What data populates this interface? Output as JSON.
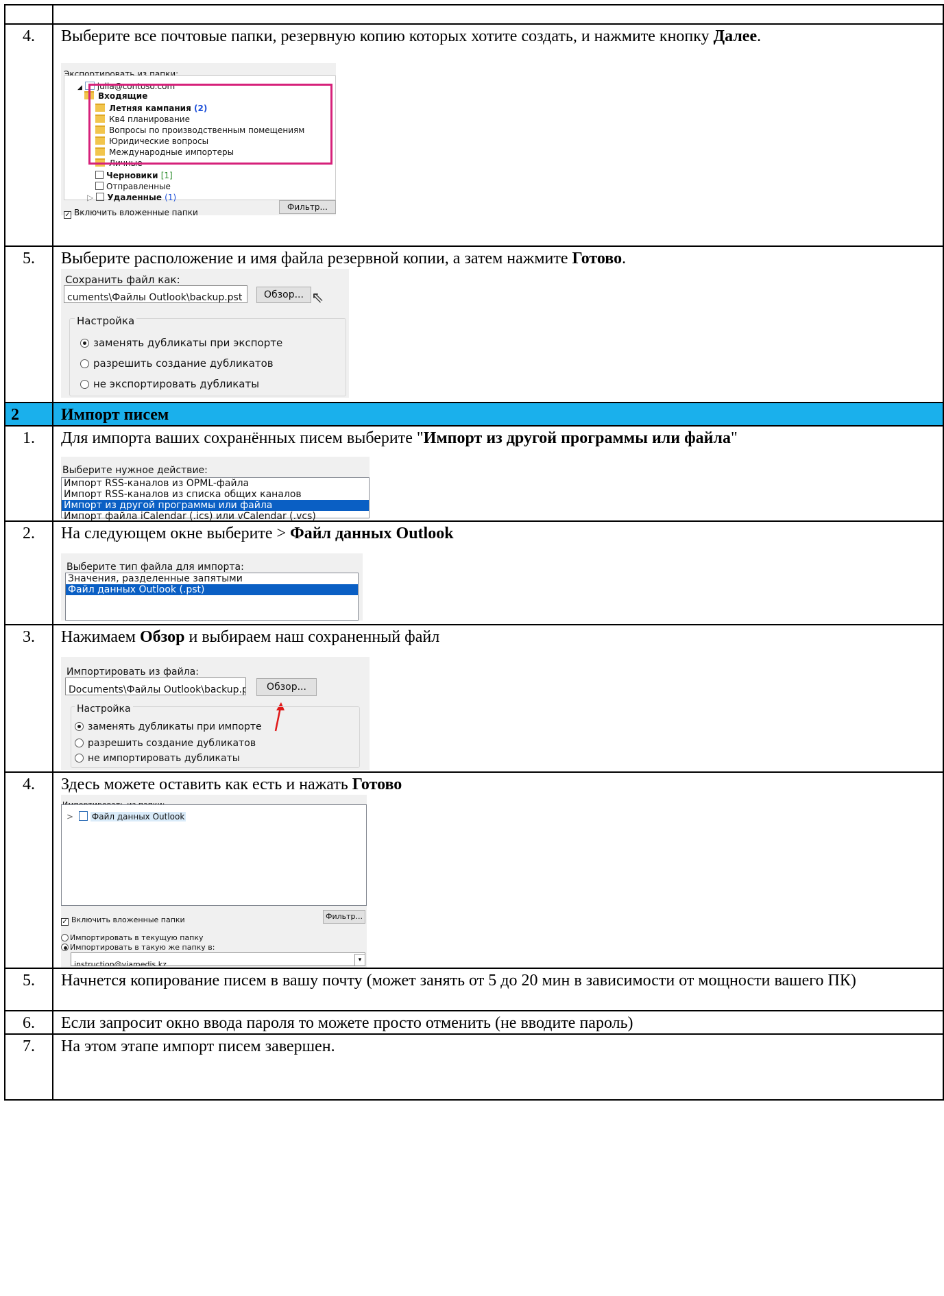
{
  "rows": {
    "r4a": {
      "num": "4.",
      "text_pre": "Выберите все почтовые папки, резервную копию которых хотите создать, и нажмите кнопку ",
      "text_bold": "Далее",
      "text_post": "."
    },
    "r5a": {
      "num": "5.",
      "text_pre": "Выберите расположение и имя файла резервной копии, а затем нажмите ",
      "text_bold": "Готово",
      "text_post": "."
    },
    "section": {
      "num": "2",
      "title": "Импорт писем"
    },
    "r1": {
      "num": "1.",
      "text_pre": "Для импорта ваших сохранённых писем выберите \"",
      "text_bold": "Импорт из другой программы или файла",
      "text_post": "\""
    },
    "r2": {
      "num": "2.",
      "text_pre": "На следующем окне выберите > ",
      "text_bold": "Файл данных Outlook"
    },
    "r3": {
      "num": "3.",
      "text_pre": "Нажимаем ",
      "text_bold": "Обзор",
      "text_post": " и выбираем наш сохраненный файл"
    },
    "r4b": {
      "num": "4.",
      "text_pre": "Здесь можете оставить как есть и нажать ",
      "text_bold": "Готово"
    },
    "r5b": {
      "num": "5.",
      "text": "Начнется копирование писем в вашу почту (может занять от 5 до 20 мин в зависимости от мощности вашего ПК)"
    },
    "r6": {
      "num": "6.",
      "text": "Если запросит окно ввода пароля то можете просто отменить (не вводите пароль)"
    },
    "r7": {
      "num": "7.",
      "text": "На этом этапе импорт писем завершен."
    }
  },
  "shot_export_folders": {
    "label": "Экспортировать из папки:",
    "account": "julia@contoso.com",
    "inbox": "Входящие",
    "folders": [
      {
        "name": "Летняя кампания",
        "count": "(2)"
      },
      {
        "name": "Кв4 планирование"
      },
      {
        "name": "Вопросы по производственным помещениям"
      },
      {
        "name": "Юридические вопросы"
      },
      {
        "name": "Международные импортеры"
      },
      {
        "name": "Личные"
      }
    ],
    "drafts": "Черновики",
    "drafts_count": "[1]",
    "sent": "Отправленные",
    "deleted": "Удаленные",
    "deleted_count": "(1)",
    "include_subfolders": "Включить вложенные папки",
    "filter_button": "Фильтр...",
    "highlight_color": "#d6217a"
  },
  "shot_save_as": {
    "label": "Сохранить файл как:",
    "path": "cuments\\Файлы Outlook\\backup.pst",
    "browse": "Обзор...",
    "group": "Настройка",
    "options": [
      "заменять дубликаты при экспорте",
      "разрешить создание дубликатов",
      "не экспортировать дубликаты"
    ]
  },
  "shot_action": {
    "label": "Выберите нужное действие:",
    "items": [
      "Импорт RSS-каналов из OPML-файла",
      "Импорт RSS-каналов из списка общих каналов",
      "Импорт из другой программы или файла",
      "Импорт файла iCalendar (.ics) или vCalendar (.vcs)"
    ],
    "selected_index": 2
  },
  "shot_filetype": {
    "label": "Выберите тип файла для импорта:",
    "items": [
      "Значения, разделенные запятыми",
      "Файл данных Outlook (.pst)"
    ],
    "selected_index": 1
  },
  "shot_import_file": {
    "label": "Импортировать из файла:",
    "path": "Documents\\Файлы Outlook\\backup.pst",
    "browse": "Обзор...",
    "group": "Настройка",
    "options": [
      "заменять дубликаты при импорте",
      "разрешить создание дубликатов",
      "не импортировать дубликаты"
    ]
  },
  "shot_import_folders": {
    "label": "Импортировать из папки:",
    "tree_item": "Файл данных Outlook",
    "include_subfolders": "Включить вложенные папки",
    "filter_button": "Фильтр...",
    "opt_current": "Импортировать в текущую папку",
    "opt_same": "Импортировать в такую же папку в:",
    "account": "instruction@viamedis.kz"
  },
  "colors": {
    "section_bg": "#1ab0ec",
    "selection": "#0a5fc4",
    "arrow": "#e01818"
  }
}
